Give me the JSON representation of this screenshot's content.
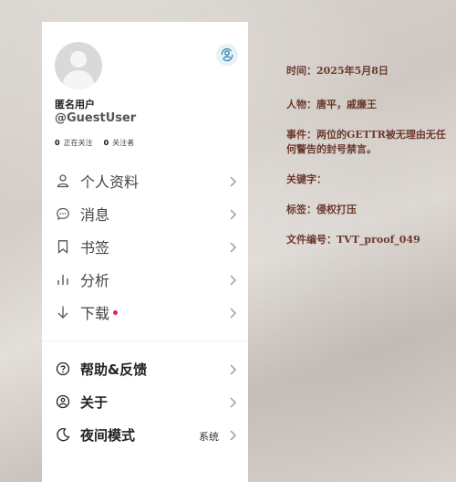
{
  "profile": {
    "display_name": "匿名用户",
    "username": "@GuestUser",
    "following_count": "0",
    "following_label": "正在关注",
    "followers_count": "0",
    "followers_label": "关注者"
  },
  "menu_primary": [
    {
      "label": "个人资料",
      "icon": "user-icon"
    },
    {
      "label": "消息",
      "icon": "message-icon"
    },
    {
      "label": "书签",
      "icon": "bookmark-icon"
    },
    {
      "label": "分析",
      "icon": "analytics-icon"
    },
    {
      "label": "下载",
      "icon": "download-icon",
      "badge_color": "#e0244a"
    }
  ],
  "menu_secondary": [
    {
      "label": "帮助&反馈",
      "icon": "help-icon"
    },
    {
      "label": "关于",
      "icon": "about-icon"
    },
    {
      "label": "夜间模式",
      "icon": "moon-icon",
      "value": "系统"
    }
  ],
  "info": {
    "time": "时间：2025年5月8日",
    "people": "人物：唐平，戚廉王",
    "event": "事件：两位的GETTR被无理由无任何警告的封号禁言。",
    "keywords": "关键字：",
    "tags": "标签：侵权打压",
    "doc_id": "文件编号：TVT_proof_049"
  },
  "colors": {
    "info_text": "#6b3a2e",
    "accent_badge": "#e0244a",
    "switch_bg": "#e6f2f7"
  }
}
